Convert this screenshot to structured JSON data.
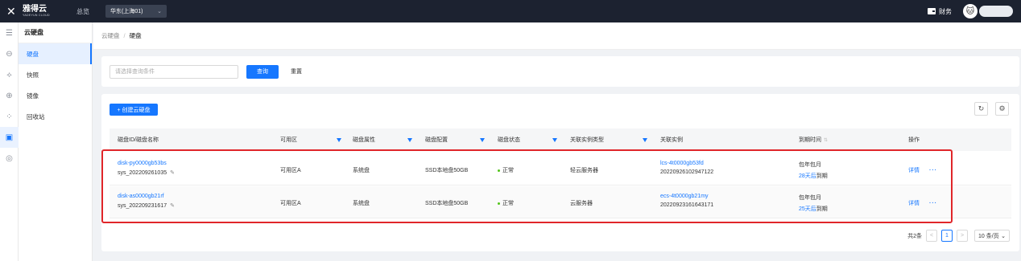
{
  "topbar": {
    "logo_cn": "雅得云",
    "logo_en": "YADEYUN CLOUD",
    "overview": "总览",
    "region": "华东(上海01)",
    "finance": "财务"
  },
  "sidebar": {
    "title": "云硬盘",
    "items": [
      {
        "label": "硬盘",
        "icon": "disk-icon"
      },
      {
        "label": "快照",
        "icon": "snapshot-icon"
      },
      {
        "label": "镜像",
        "icon": "image-icon"
      },
      {
        "label": "回收站",
        "icon": "recycle-icon"
      }
    ]
  },
  "breadcrumb": {
    "parent": "云硬盘",
    "sep": "/",
    "current": "硬盘"
  },
  "search": {
    "placeholder": "请选择查询条件",
    "query_label": "查询",
    "reset_label": "重置"
  },
  "toolbar": {
    "create_label": "+ 创建云硬盘"
  },
  "table": {
    "columns": [
      "磁盘ID/磁盘名称",
      "可用区",
      "磁盘属性",
      "磁盘配置",
      "磁盘状态",
      "关联实例类型",
      "关联实例",
      "到期时间",
      "操作"
    ],
    "rows": [
      {
        "id": "disk-py0000gb53bs",
        "name": "sys_20220926103​5",
        "zone": "可用区A",
        "attr": "系统盘",
        "config": "SSD本地盘50GB",
        "status": "正常",
        "instance_type": "轻云服务器",
        "instance_id": "lcs-4t0000gb53fd",
        "instance_name": "20220926102947122",
        "billing": "包年包月",
        "expiry_days": "28天后",
        "expiry_suffix": "到期",
        "action": "详情",
        "more": "···"
      },
      {
        "id": "disk-as0000gb21rf",
        "name": "sys_202209231617",
        "zone": "可用区A",
        "attr": "系统盘",
        "config": "SSD本地盘50GB",
        "status": "正常",
        "instance_type": "云服务器",
        "instance_id": "ecs-4t0000gb21my",
        "instance_name": "20220923161643171",
        "billing": "包年包月",
        "expiry_days": "25天后",
        "expiry_suffix": "到期",
        "action": "详情",
        "more": "···"
      }
    ]
  },
  "pagination": {
    "total": "共2条",
    "prev": "<",
    "page": "1",
    "next": ">",
    "page_size": "10 条/页"
  },
  "colors": {
    "accent": "#1677ff",
    "topbar": "#1c2230",
    "highlight": "#e0262a",
    "status_ok": "#52c41a"
  }
}
